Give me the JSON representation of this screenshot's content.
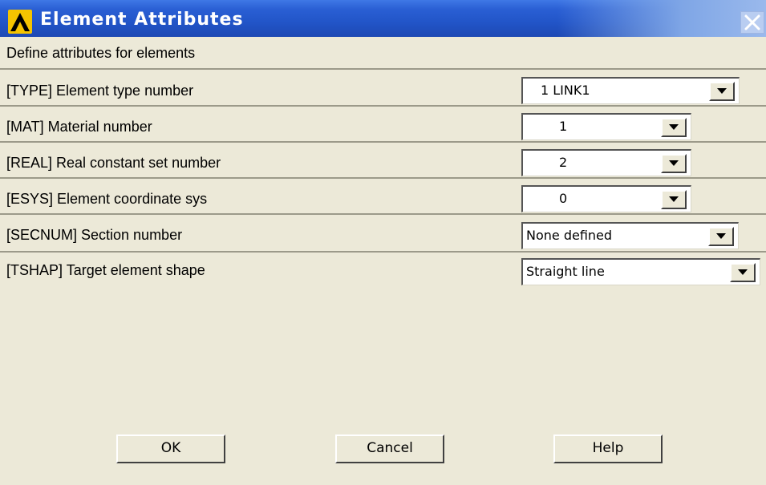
{
  "window": {
    "title": "Element Attributes",
    "subtitle": "Define attributes for elements",
    "titlebar_color": "#2255c8",
    "icons": {
      "app": "ansys-logo-icon",
      "close": "close-icon"
    }
  },
  "rows": [
    {
      "label": "[TYPE]  Element type number",
      "value": "1    LINK1"
    },
    {
      "label": "[MAT]  Material number",
      "value": "1"
    },
    {
      "label": "[REAL]  Real constant set number",
      "value": "2"
    },
    {
      "label": "[ESYS]  Element coordinate sys",
      "value": "0"
    },
    {
      "label": "[SECNUM]  Section number",
      "value": "None defined"
    },
    {
      "label": "[TSHAP]  Target element shape",
      "value": "Straight line"
    }
  ],
  "buttons": {
    "ok": "OK",
    "cancel": "Cancel",
    "help": "Help"
  }
}
